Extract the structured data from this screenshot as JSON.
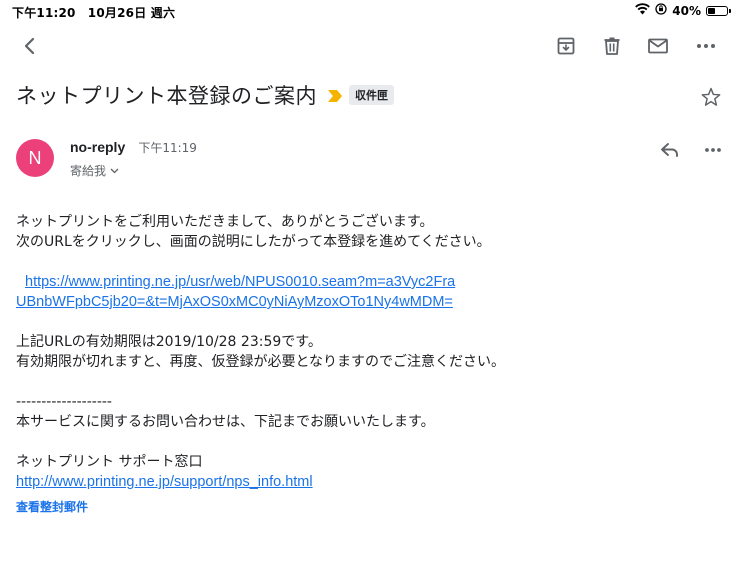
{
  "status_bar": {
    "time": "下午11:20　10月26日 週六",
    "battery_text": "40%",
    "battery_level": 0.4
  },
  "toolbar": {
    "icons": [
      "back-icon",
      "archive-icon",
      "delete-icon",
      "mail-icon",
      "more-icon"
    ]
  },
  "email": {
    "subject": "ネットプリント本登録のご案内",
    "label": "収件匣",
    "sender": {
      "initial": "N",
      "name": "no-reply",
      "time": "下午11:19",
      "recipient": "寄給我",
      "avatar_color": "#ec407a"
    },
    "body": {
      "line1": "ネットプリントをご利用いただきまして、ありがとうございます。",
      "line2": "次のURLをクリックし、画面の説明にしたがって本登録を進めてください。",
      "link_line1": "https://www.printing.ne.jp/usr/web/NPUS0010.seam?m=a3Vyc2Fra",
      "link_line2": "UBnbWFpbC5jb20=&t=MjAxOS0xMC0yNiAyMzoxOTo1Ny4wMDM=",
      "line3": "上記URLの有効期限は2019/10/28 23:59です。",
      "line4": "有効期限が切れますと、再度、仮登録が必要となりますのでご注意ください。",
      "divider": "-------------------",
      "line5": "本サービスに関するお問い合わせは、下記までお願いいたします。",
      "support_title": "ネットプリント サポート窓口",
      "support_link": "http://www.printing.ne.jp/support/nps_info.html"
    },
    "show_trimmed": "查看整封郵件"
  },
  "colors": {
    "accent": "#1a73e8",
    "importance": "#f4b400",
    "icon": "#5f6368"
  }
}
